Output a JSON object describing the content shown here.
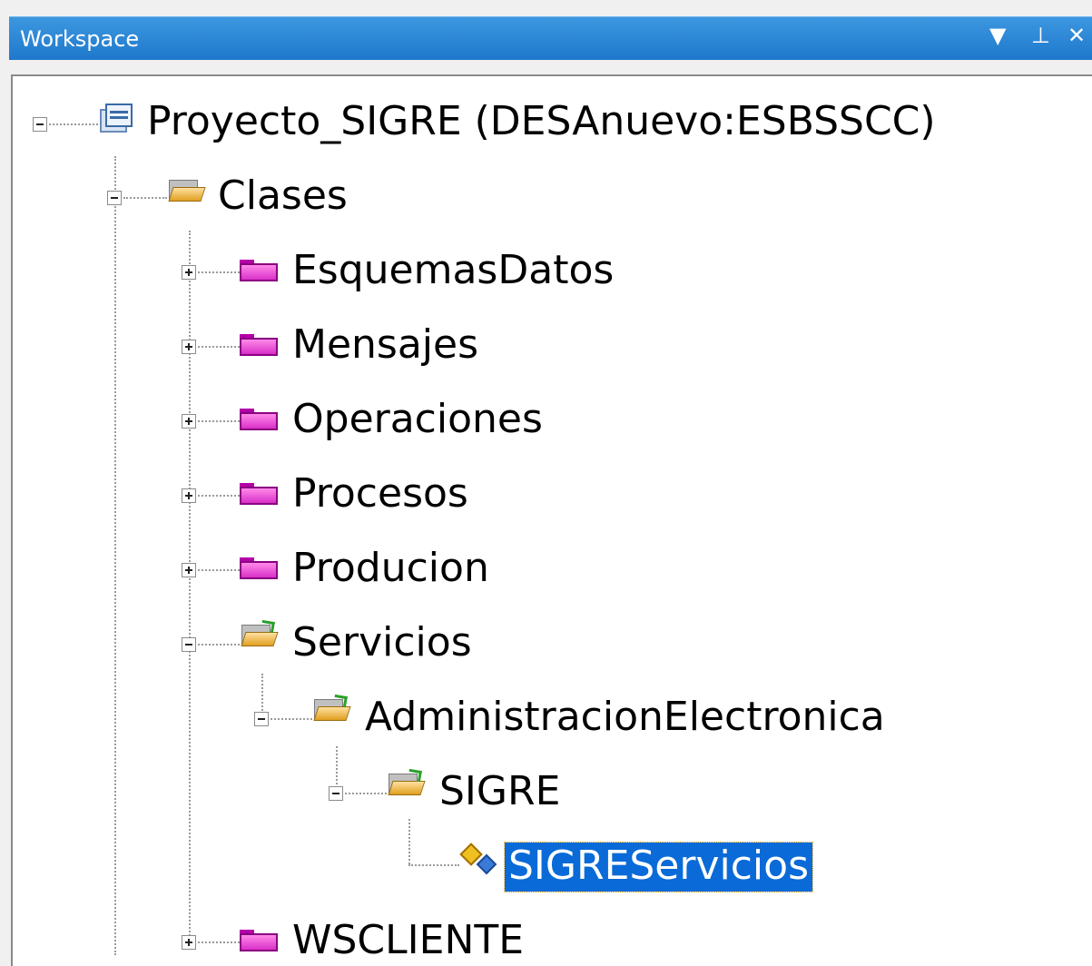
{
  "panel": {
    "title": "Workspace",
    "controls": {
      "dropdown": "▼",
      "pin": "⊥",
      "close": "✕"
    }
  },
  "tree": {
    "root": "Proyecto_SIGRE  (DESAnuevo:ESBSSCC)",
    "clases": "Clases",
    "esquemas": "EsquemasDatos",
    "mensajes": "Mensajes",
    "operaciones": "Operaciones",
    "procesos": "Procesos",
    "producion": "Producion",
    "servicios": "Servicios",
    "administracion": "AdministracionElectronica",
    "sigre": "SIGRE",
    "sigreservicios": "SIGREServicios",
    "wscliente": "WSCLIENTE"
  },
  "colors": {
    "titlebar": "#1f78cc",
    "selection": "#0a6ad8",
    "folder_closed": "#d830c8",
    "folder_open": "#e0a020"
  }
}
